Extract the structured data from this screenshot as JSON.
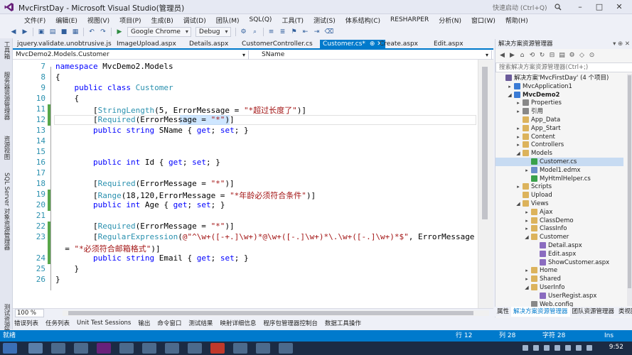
{
  "window": {
    "title": "MvcFirstDay - Microsoft Visual Studio(管理员)",
    "quick_launch_placeholder": "快速启动 (Ctrl+Q)"
  },
  "menu": [
    "文件(F)",
    "编辑(E)",
    "视图(V)",
    "项目(P)",
    "生成(B)",
    "调试(D)",
    "团队(M)",
    "SQL(Q)",
    "工具(T)",
    "测试(S)",
    "体系结构(C)",
    "RESHARPER",
    "分析(N)",
    "窗口(W)",
    "帮助(H)"
  ],
  "toolbar": {
    "browser": "Google Chrome",
    "config": "Debug"
  },
  "left_strip": [
    "工具箱",
    "服务器资源管理器",
    "资源视图",
    "SQL Server 对象资源管理器",
    "测试资源管理器"
  ],
  "tabs": [
    {
      "label": "jquery.validate.unobtrusive.js",
      "active": false
    },
    {
      "label": "ImageUpload.aspx",
      "active": false
    },
    {
      "label": "Details.aspx",
      "active": false
    },
    {
      "label": "CustomerController.cs",
      "active": false
    },
    {
      "label": "Customer.cs*",
      "active": true
    },
    {
      "label": "Create.aspx",
      "active": false
    },
    {
      "label": "Edit.aspx",
      "active": false
    }
  ],
  "tab_pin_icons": "⊕ ✕",
  "nav": {
    "left": "MvcDemo2.Models.Customer",
    "right": "SName"
  },
  "code_lines": [
    {
      "n": "7",
      "parts": [
        [
          "kw",
          "namespace"
        ],
        [
          "t",
          " MvcDemo2.Models"
        ]
      ]
    },
    {
      "n": "8",
      "parts": [
        [
          "t",
          "{"
        ]
      ]
    },
    {
      "n": "9",
      "parts": [
        [
          "t",
          "    "
        ],
        [
          "kw",
          "public"
        ],
        [
          "t",
          " "
        ],
        [
          "kw",
          "class"
        ],
        [
          "t",
          " "
        ],
        [
          "ty",
          "Customer"
        ]
      ]
    },
    {
      "n": "10",
      "parts": [
        [
          "t",
          "    {"
        ]
      ]
    },
    {
      "n": "11",
      "parts": [
        [
          "t",
          "        ["
        ],
        [
          "ty",
          "StringLength"
        ],
        [
          "t",
          "(5, ErrorMessage = "
        ],
        [
          "st",
          "\"*超过长度了\""
        ],
        [
          "t",
          ")]"
        ]
      ]
    },
    {
      "n": "12",
      "parts": [
        [
          "t",
          "        ["
        ],
        [
          "ty",
          "Required"
        ],
        [
          "t",
          "(ErrorMessage = "
        ],
        [
          "st",
          "\"*\""
        ],
        [
          "t",
          ")]"
        ]
      ]
    },
    {
      "n": "13",
      "parts": [
        [
          "t",
          "        "
        ],
        [
          "kw",
          "public"
        ],
        [
          "t",
          " "
        ],
        [
          "kw",
          "string"
        ],
        [
          "t",
          " SName { "
        ],
        [
          "kw",
          "get"
        ],
        [
          "t",
          "; "
        ],
        [
          "kw",
          "set"
        ],
        [
          "t",
          "; }"
        ]
      ]
    },
    {
      "n": "14",
      "parts": [
        [
          "t",
          ""
        ]
      ]
    },
    {
      "n": "15",
      "parts": [
        [
          "t",
          ""
        ]
      ]
    },
    {
      "n": "16",
      "parts": [
        [
          "t",
          "        "
        ],
        [
          "kw",
          "public"
        ],
        [
          "t",
          " "
        ],
        [
          "kw",
          "int"
        ],
        [
          "t",
          " Id { "
        ],
        [
          "kw",
          "get"
        ],
        [
          "t",
          "; "
        ],
        [
          "kw",
          "set"
        ],
        [
          "t",
          "; }"
        ]
      ]
    },
    {
      "n": "17",
      "parts": [
        [
          "t",
          ""
        ]
      ]
    },
    {
      "n": "18",
      "parts": [
        [
          "t",
          "        ["
        ],
        [
          "ty",
          "Required"
        ],
        [
          "t",
          "(ErrorMessage = "
        ],
        [
          "st",
          "\"*\""
        ],
        [
          "t",
          ")]"
        ]
      ]
    },
    {
      "n": "19",
      "parts": [
        [
          "t",
          "        ["
        ],
        [
          "ty",
          "Range"
        ],
        [
          "t",
          "(18,120,ErrorMessage = "
        ],
        [
          "st",
          "\"*年龄必须符合条件\""
        ],
        [
          "t",
          ")]"
        ]
      ]
    },
    {
      "n": "20",
      "parts": [
        [
          "t",
          "        "
        ],
        [
          "kw",
          "public"
        ],
        [
          "t",
          " "
        ],
        [
          "kw",
          "int"
        ],
        [
          "t",
          " Age { "
        ],
        [
          "kw",
          "get"
        ],
        [
          "t",
          "; "
        ],
        [
          "kw",
          "set"
        ],
        [
          "t",
          "; }"
        ]
      ]
    },
    {
      "n": "21",
      "parts": [
        [
          "t",
          ""
        ]
      ]
    },
    {
      "n": "22",
      "parts": [
        [
          "t",
          "        ["
        ],
        [
          "ty",
          "Required"
        ],
        [
          "t",
          "(ErrorMessage = "
        ],
        [
          "st",
          "\"*\""
        ],
        [
          "t",
          ")]"
        ]
      ]
    },
    {
      "n": "23",
      "parts": [
        [
          "t",
          "        ["
        ],
        [
          "ty",
          "RegularExpression"
        ],
        [
          "t",
          "("
        ],
        [
          "st",
          "@\"^\\w+([-+.]\\w+)*@\\w+([-.]\\w+)*\\.\\w+([-.]\\w+)*$\""
        ],
        [
          "t",
          ", ErrorMessage"
        ]
      ]
    },
    {
      "n": "",
      "parts": [
        [
          "t",
          "  = "
        ],
        [
          "st",
          "\"*必须符合邮箱格式\""
        ],
        [
          "t",
          ")]"
        ]
      ]
    },
    {
      "n": "24",
      "parts": [
        [
          "t",
          "        "
        ],
        [
          "kw",
          "public"
        ],
        [
          "t",
          " "
        ],
        [
          "kw",
          "string"
        ],
        [
          "t",
          " Email { "
        ],
        [
          "kw",
          "get"
        ],
        [
          "t",
          "; "
        ],
        [
          "kw",
          "set"
        ],
        [
          "t",
          "; }"
        ]
      ]
    },
    {
      "n": "25",
      "parts": [
        [
          "t",
          "    }"
        ]
      ]
    },
    {
      "n": "26",
      "parts": [
        [
          "t",
          "}"
        ]
      ]
    }
  ],
  "zoom": "100 %",
  "bottom_tabs": [
    "错误列表",
    "任务列表",
    "Unit Test Sessions",
    "输出",
    "命令窗口",
    "测试结果",
    "映射详细信息",
    "程序包管理器控制台",
    "数据工具操作"
  ],
  "solution": {
    "header": "解决方案资源管理器",
    "search_placeholder": "搜索解决方案资源管理器(Ctrl+;)",
    "tree": [
      {
        "label": "解决方案'MvcFirstDay' (4 个项目)",
        "depth": 0,
        "exp": "",
        "color": "#6b5b9a"
      },
      {
        "label": "MvcApplication1",
        "depth": 1,
        "exp": "▸",
        "color": "#3a7bd5"
      },
      {
        "label": "MvcDemo2",
        "depth": 1,
        "exp": "◢",
        "color": "#3a7bd5",
        "bold": true
      },
      {
        "label": "Properties",
        "depth": 2,
        "exp": "▸",
        "color": "#888"
      },
      {
        "label": "引用",
        "depth": 2,
        "exp": "▸",
        "color": "#888"
      },
      {
        "label": "App_Data",
        "depth": 2,
        "exp": "",
        "color": "#dcb35c"
      },
      {
        "label": "App_Start",
        "depth": 2,
        "exp": "▸",
        "color": "#dcb35c"
      },
      {
        "label": "Content",
        "depth": 2,
        "exp": "▸",
        "color": "#dcb35c"
      },
      {
        "label": "Controllers",
        "depth": 2,
        "exp": "▸",
        "color": "#dcb35c"
      },
      {
        "label": "Models",
        "depth": 2,
        "exp": "◢",
        "color": "#dcb35c"
      },
      {
        "label": "Customer.cs",
        "depth": 3,
        "exp": "",
        "color": "#3aa14b",
        "sel": true
      },
      {
        "label": "Model1.edmx",
        "depth": 3,
        "exp": "▸",
        "color": "#6b8fc9"
      },
      {
        "label": "MyHtmlHelper.cs",
        "depth": 3,
        "exp": "",
        "color": "#3aa14b"
      },
      {
        "label": "Scripts",
        "depth": 2,
        "exp": "▸",
        "color": "#dcb35c"
      },
      {
        "label": "Upload",
        "depth": 2,
        "exp": "",
        "color": "#dcb35c"
      },
      {
        "label": "Views",
        "depth": 2,
        "exp": "◢",
        "color": "#dcb35c"
      },
      {
        "label": "Ajax",
        "depth": 3,
        "exp": "▸",
        "color": "#dcb35c"
      },
      {
        "label": "ClassDemo",
        "depth": 3,
        "exp": "▸",
        "color": "#dcb35c"
      },
      {
        "label": "ClassInfo",
        "depth": 3,
        "exp": "▸",
        "color": "#dcb35c"
      },
      {
        "label": "Customer",
        "depth": 3,
        "exp": "◢",
        "color": "#dcb35c"
      },
      {
        "label": "Detail.aspx",
        "depth": 4,
        "exp": "",
        "color": "#8a6bbf"
      },
      {
        "label": "Edit.aspx",
        "depth": 4,
        "exp": "",
        "color": "#8a6bbf"
      },
      {
        "label": "ShowCustomer.aspx",
        "depth": 4,
        "exp": "",
        "color": "#8a6bbf"
      },
      {
        "label": "Home",
        "depth": 3,
        "exp": "▸",
        "color": "#dcb35c"
      },
      {
        "label": "Shared",
        "depth": 3,
        "exp": "▸",
        "color": "#dcb35c"
      },
      {
        "label": "UserInfo",
        "depth": 3,
        "exp": "◢",
        "color": "#dcb35c"
      },
      {
        "label": "UserRegist.aspx",
        "depth": 4,
        "exp": "",
        "color": "#8a6bbf"
      },
      {
        "label": "Web.config",
        "depth": 3,
        "exp": "",
        "color": "#888"
      }
    ]
  },
  "sol_tabs": [
    "属性",
    "解决方案资源管理器",
    "团队资源管理器",
    "类视图"
  ],
  "status": {
    "left": "就绪",
    "line": "行 12",
    "col": "列 28",
    "char": "字符 28",
    "mode": "Ins"
  },
  "clock": "9:52"
}
